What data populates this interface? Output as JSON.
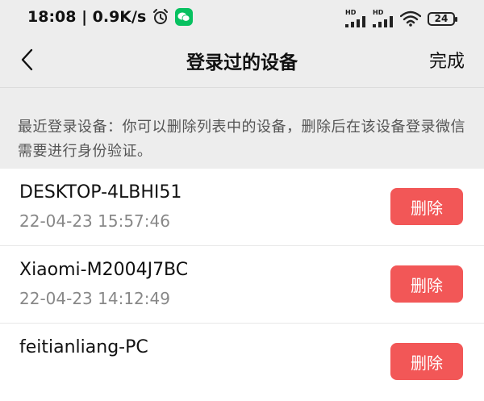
{
  "status_bar": {
    "time_speed": "18:08 | 0.9K/s",
    "sim1_label": "HD",
    "sim2_label": "HD",
    "battery_level": "24",
    "icons": [
      "alarm-icon",
      "wechat-icon",
      "signal-icon",
      "signal-icon",
      "wifi-icon",
      "battery-icon"
    ]
  },
  "header": {
    "title": "登录过的设备",
    "done_label": "完成",
    "back_icon": "chevron-left-icon"
  },
  "description": "最近登录设备：你可以删除列表中的设备，删除后在该设备登录微信需要进行身份验证。",
  "devices": [
    {
      "name": "DESKTOP-4LBHI51",
      "time": "22-04-23 15:57:46",
      "delete_label": "删除"
    },
    {
      "name": "Xiaomi-M2004J7BC",
      "time": "22-04-23 14:12:49",
      "delete_label": "删除"
    },
    {
      "name": "feitianliang-PC",
      "time": "",
      "delete_label": "删除"
    }
  ],
  "colors": {
    "delete": "#f25757",
    "background": "#ededed",
    "wechat": "#07c160"
  }
}
